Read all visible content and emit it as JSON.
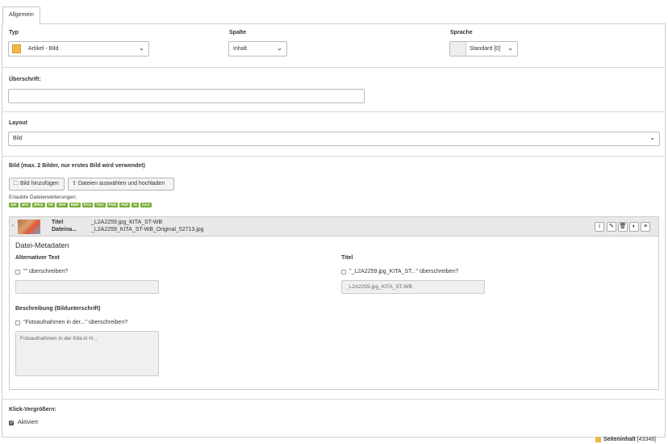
{
  "tabs": {
    "active": "Allgemein"
  },
  "typ": {
    "label": "Typ",
    "value": "Artikel - Bild"
  },
  "spalte": {
    "label": "Spalte",
    "value": "Inhalt"
  },
  "sprache": {
    "label": "Sprache",
    "value": "Standard [0]"
  },
  "ueberschrift": {
    "label": "Überschrift:",
    "value": ""
  },
  "layout": {
    "label": "Layout",
    "value": "Bild"
  },
  "bild": {
    "label": "Bild (max. 2 Bilder, nur erstes Bild wird verwendet)",
    "add_button": "Bild hinzufügen",
    "upload_button": "Dateien auswählen und hochladen",
    "allowed_label": "Erlaubte Dateierweiterungen:",
    "extensions": [
      "GIF",
      "JPG",
      "JPEG",
      "TIF",
      "TIFF",
      "BMP",
      "PCX",
      "TGA",
      "PNG",
      "PDF",
      "AI",
      "AAA"
    ]
  },
  "file": {
    "title_label": "Titel",
    "title_value": "_L2A2259.jpg_KITA_ST-WB",
    "filename_label": "Dateina...",
    "filename_value": "_L2A2259_KITA_ST-WB_Original_52713.jpg",
    "icons": [
      "info-icon",
      "edit-icon",
      "delete-icon",
      "toggle-icon",
      "menu-icon"
    ]
  },
  "metadata": {
    "heading": "Datei-Metadaten",
    "alt": {
      "label": "Alternativer Text",
      "override": "\"\" überschreiben?",
      "value": ""
    },
    "title": {
      "label": "Titel",
      "override": "\"_L2A2259.jpg_KITA_ST...\" überschreiben?",
      "value": "_L2A2259.jpg_KITA_ST-WB"
    },
    "desc": {
      "label": "Beschreibung (Bildunterschrift)",
      "override": "\"Fotoaufnahmen in der...\" überschreiben?",
      "value": "Fotoaufnahmen in der Kita in H..."
    }
  },
  "klick": {
    "label": "Klick-Vergrößern:",
    "checkbox_label": "Aktiviert",
    "checked": true
  },
  "footer": {
    "label": "Seiteninhalt",
    "id": "[43348]"
  }
}
